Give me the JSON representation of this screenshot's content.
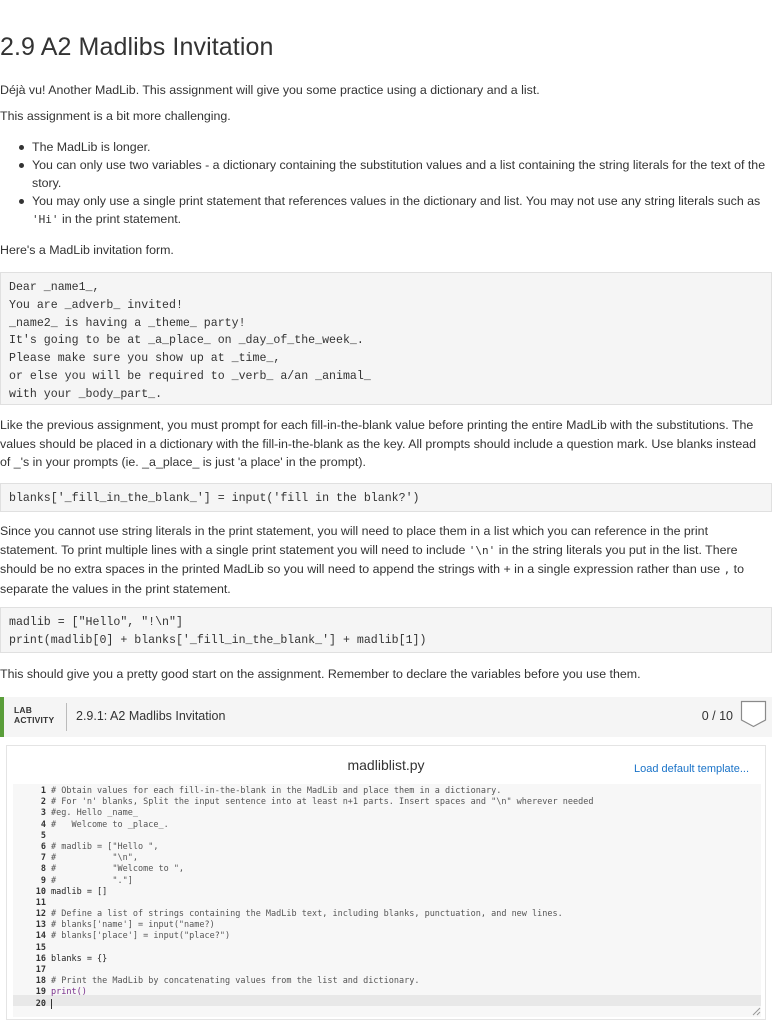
{
  "title": "2.9 A2 Madlibs Invitation",
  "intro": "Déjà vu! Another MadLib. This assignment will give you some practice using a dictionary and a list.",
  "challenge": "This assignment is a bit more challenging.",
  "bullets": {
    "b1": "The MadLib is longer.",
    "b2": "You can only use two variables - a dictionary containing the substitution values and a list containing the string literals for the text of the story.",
    "b3_pre": "You may only use a single print statement that references values in the dictionary and list. You may not use any string literals such as",
    "b3_code": "'Hi'",
    "b3_post": " in the print statement."
  },
  "form_intro": "Here's a MadLib invitation form.",
  "form_lines": [
    "Dear _name1_,",
    "You are _adverb_ invited!",
    "_name2_ is having a _theme_ party!",
    "It's going to be at _a_place_ on _day_of_the_week_.",
    "Please make sure you show up at _time_,",
    "or else you will be required to _verb_ a/an _animal_",
    "with your _body_part_."
  ],
  "prompt_para": "Like the previous assignment, you must prompt for each fill-in-the-blank value before printing the entire MadLib with the substitutions. The values should be placed in a dictionary with the fill-in-the-blank as the key. All prompts should include a question mark. Use blanks instead of _'s in your prompts (ie. _a_place_ is just 'a place' in the prompt).",
  "code1": "blanks['_fill_in_the_blank_'] = input('fill in the blank?')",
  "literal_para": {
    "p1": "Since you cannot use string literals in the print statement, you will need to place them in a list which you can reference in the print statement. To print multiple lines with a single print statement you will need to include ",
    "c1": "'\\n'",
    "p2": " in the string literals you put in the list. There should be no extra spaces in the printed MadLib so you will need to append the strings with + in a single expression rather than use ",
    "c2": ",",
    "p3": " to separate the values in the print statement."
  },
  "code2": [
    "madlib = [\"Hello\", \"!\\n\"]",
    "print(madlib[0] + blanks['_fill_in_the_blank_'] + madlib[1])"
  ],
  "closing": "This should give you a pretty good start on the assignment. Remember to declare the variables before you use them.",
  "lab": {
    "tag_line1": "LAB",
    "tag_line2": "ACTIVITY",
    "title": "2.9.1: A2 Madlibs Invitation",
    "score": "0 / 10",
    "accent": "#5a9e3a"
  },
  "editor": {
    "filename": "madliblist.py",
    "load_template": "Load default template...",
    "line_numbers": [
      "1",
      "2",
      "3",
      "4",
      "5",
      "6",
      "7",
      "8",
      "9",
      "10",
      "11",
      "12",
      "13",
      "14",
      "15",
      "16",
      "17",
      "18",
      "19",
      "20"
    ],
    "lines": [
      "# Obtain values for each fill-in-the-blank in the MadLib and place them in a dictionary.",
      "# For 'n' blanks, Split the input sentence into at least n+1 parts. Insert spaces and \"\\n\" wherever needed",
      "#eg. Hello _name_",
      "#   Welcome to _place_.",
      "",
      "# madlib = [\"Hello \",",
      "#           \"\\n\",",
      "#           \"Welcome to \",",
      "#           \".\"]",
      "madlib = []",
      "",
      "# Define a list of strings containing the MadLib text, including blanks, punctuation, and new lines.",
      "# blanks['name'] = input(\"name?)",
      "# blanks['place'] = input(\"place?\")",
      "",
      "blanks = {}",
      "",
      "# Print the MadLib by concatenating values from the list and dictionary.",
      "print()",
      ""
    ]
  }
}
